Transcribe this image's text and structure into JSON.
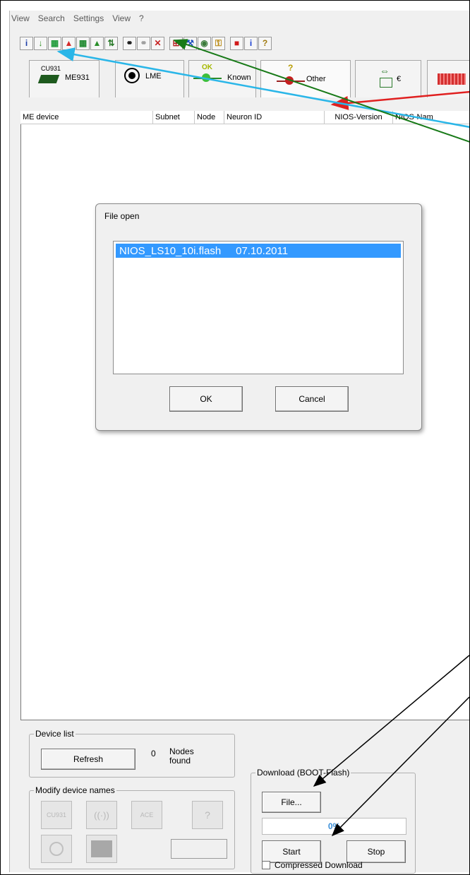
{
  "menu": [
    "View",
    "Search",
    "Settings",
    "View",
    "?"
  ],
  "toolbar_icons": [
    {
      "name": "info-icon",
      "glyph": "i",
      "color": "#1e3fa8"
    },
    {
      "name": "download-icon",
      "glyph": "↓",
      "color": "#2f8f22"
    },
    {
      "name": "grid-green-icon",
      "glyph": "▦",
      "color": "#1f9b3a"
    },
    {
      "name": "warning-triangle-icon",
      "glyph": "▲",
      "color": "#d42a2a"
    },
    {
      "name": "grid-icon",
      "glyph": "▦",
      "color": "#208a30"
    },
    {
      "name": "upload-icon",
      "glyph": "▲",
      "color": "#2a8f2a"
    },
    {
      "name": "transfer-icon",
      "glyph": "⇅",
      "color": "#2a7a2a"
    },
    {
      "name": "binoculars-icon",
      "glyph": "⚭",
      "color": "#111111"
    },
    {
      "name": "binoculars-disabled-icon",
      "glyph": "⚭",
      "color": "#9c9c9c"
    },
    {
      "name": "cancel-search-icon",
      "glyph": "✕",
      "color": "#c62020"
    },
    {
      "name": "network-icon",
      "glyph": "⊞",
      "color": "#b52222"
    },
    {
      "name": "wrench-icon",
      "glyph": "⚒",
      "color": "#1f4fbf"
    },
    {
      "name": "settings-icon",
      "glyph": "◉",
      "color": "#3a7a3a"
    },
    {
      "name": "key-icon",
      "glyph": "⚿",
      "color": "#b8860b"
    },
    {
      "name": "exit-icon",
      "glyph": "■",
      "color": "#d11a1a"
    },
    {
      "name": "about-icon",
      "glyph": "i",
      "color": "#1a3fd1"
    },
    {
      "name": "help-icon",
      "glyph": "?",
      "color": "#a07a10"
    }
  ],
  "tabs": [
    {
      "top": "CU931",
      "label": "ME931"
    },
    {
      "label": "LME"
    },
    {
      "top": "OK",
      "label": "Known"
    },
    {
      "top": "?",
      "label": "Other"
    },
    {
      "label": "€"
    }
  ],
  "columns": [
    "ME device",
    "Subnet",
    "Node",
    "Neuron ID",
    "NIOS-Version",
    "NIOS-Nam"
  ],
  "dialog": {
    "title": "File open",
    "file": "NIOS_LS10_10i.flash",
    "date": "07.10.2011",
    "ok": "OK",
    "cancel": "Cancel"
  },
  "device_list": {
    "title": "Device list",
    "refresh": "Refresh",
    "count": "0",
    "nodes_found": "Nodes\nfound"
  },
  "modify": {
    "title": "Modify device names",
    "cu931": "CU931",
    "ace": "ACE",
    "other": "?"
  },
  "download": {
    "title": "Download (BOOT-Flash)",
    "file": "File...",
    "start": "Start",
    "stop": "Stop",
    "progress_pct": "0%",
    "progress_value": 0,
    "compressed": "Compressed Download"
  },
  "colors": {
    "progress": "#3a8fd9",
    "arrow_red": "#e02020",
    "arrow_cyan": "#2ab6e8",
    "arrow_green": "#187a18",
    "arrow_black": "#000000"
  }
}
